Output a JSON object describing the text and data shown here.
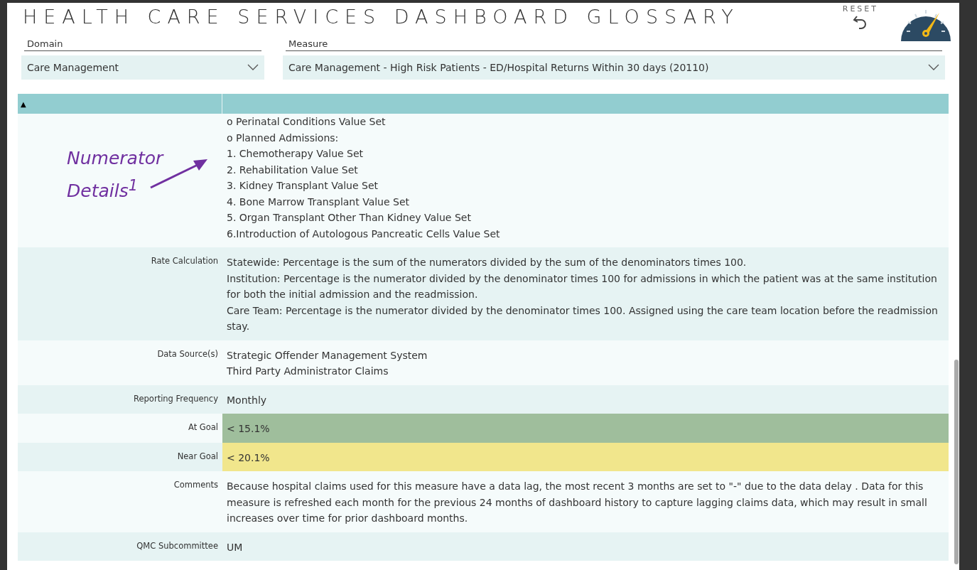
{
  "title": "HEALTH CARE SERVICES DASHBOARD GLOSSARY",
  "reset": {
    "label": "RESET"
  },
  "filters": [
    {
      "label": "Domain",
      "value": "Care Management"
    },
    {
      "label": "Measure",
      "value": "Care Management - High Risk Patients - ED/Hospital Returns Within 30 days (20110)"
    }
  ],
  "table": {
    "header_icon": "▲",
    "rows": [
      {
        "label": "",
        "lines": [
          "o Perinatal Conditions Value Set",
          "o Planned Admissions:",
          "1. Chemotherapy Value Set",
          "2. Rehabilitation Value Set",
          "3. Kidney Transplant Value Set",
          "4. Bone Marrow Transplant Value Set",
          "5. Organ Transplant Other Than Kidney Value Set",
          "6.Introduction of Autologous Pancreatic Cells Value Set"
        ]
      },
      {
        "label": "Rate Calculation",
        "lines": [
          "Statewide: Percentage is the sum of the numerators divided by the sum of the denominators times 100.",
          "Institution: Percentage is the numerator divided by the denominator times 100 for admissions in which the patient was at the same institution for both the initial admission and the readmission.",
          "Care Team: Percentage is the numerator divided by the denominator times 100. Assigned using the care team location before the readmission stay."
        ]
      },
      {
        "label": "Data Source(s)",
        "lines": [
          "Strategic Offender Management System",
          "Third Party Administrator Claims"
        ]
      },
      {
        "label": "Reporting Frequency",
        "lines": [
          "Monthly"
        ]
      },
      {
        "label": "At Goal",
        "lines": [
          "< 15.1%"
        ],
        "color": "#9fbe9c"
      },
      {
        "label": "Near Goal",
        "lines": [
          "< 20.1%"
        ],
        "color": "#f1e68c"
      },
      {
        "label": "Comments",
        "lines": [
          "Because hospital claims used for this measure have a data lag, the most recent 3 months are set to \"-\" due to the data delay . Data for this measure is refreshed each month for the previous 24 months of dashboard history to capture lagging claims data, which may result in small increases over time for prior dashboard months."
        ]
      },
      {
        "label": "QMC Subcommittee",
        "lines": [
          "UM"
        ]
      }
    ]
  },
  "annotation": {
    "text": "Numerator Details$^{1}$"
  }
}
